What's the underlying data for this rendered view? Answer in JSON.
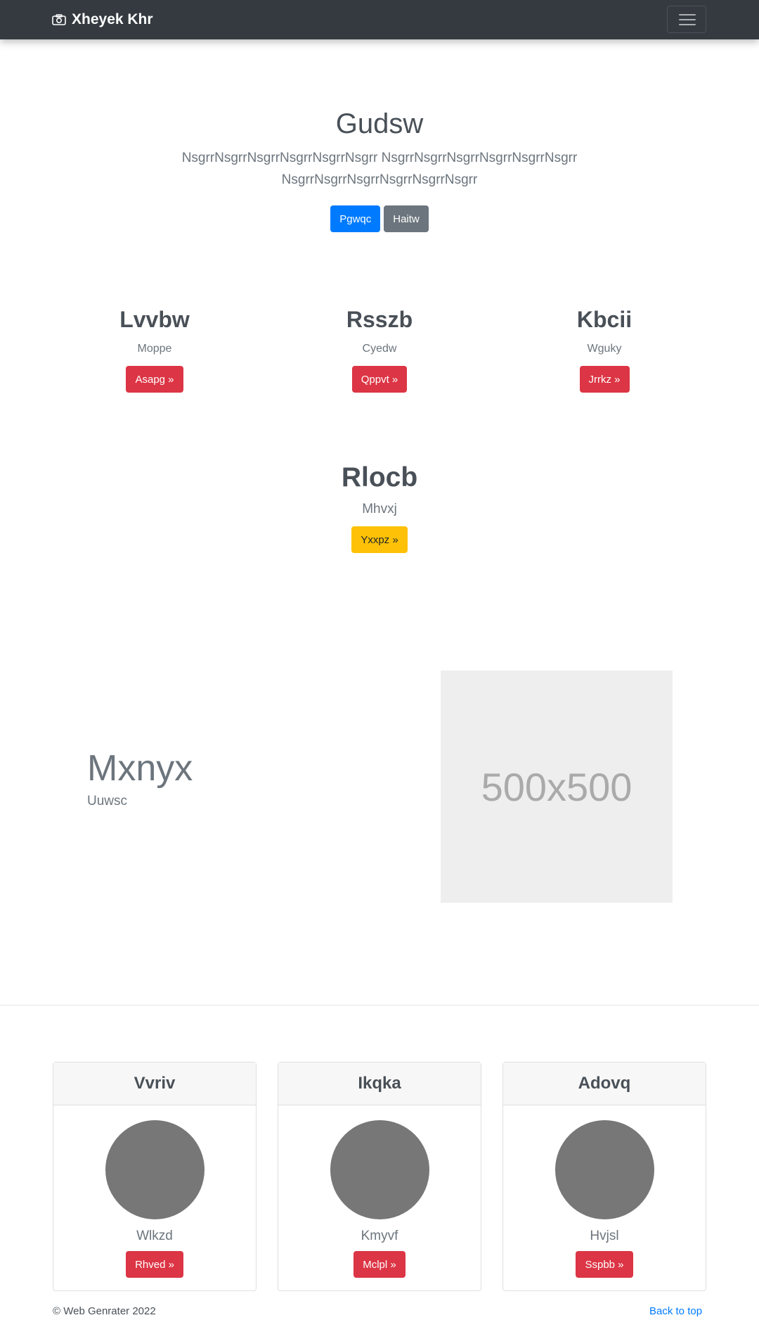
{
  "navbar": {
    "brand": "Xheyek Khr",
    "brand_icon": "camera-icon",
    "toggler_icon": "hamburger-icon"
  },
  "hero": {
    "title": "Gudsw",
    "lead": "NsgrrNsgrrNsgrrNsgrrNsgrrNsgrr NsgrrNsgrrNsgrrNsgrrNsgrrNsgrr NsgrrNsgrrNsgrrNsgrrNsgrrNsgrr",
    "primary_button": "Pgwqc",
    "secondary_button": "Haitw"
  },
  "features": [
    {
      "title": "Lvvbw",
      "text": "Moppe",
      "button": "Asapg »"
    },
    {
      "title": "Rsszb",
      "text": "Cyedw",
      "button": "Qppvt »"
    },
    {
      "title": "Kbcii",
      "text": "Wguky",
      "button": "Jrrkz »"
    }
  ],
  "feature_center": {
    "title": "Rlocb",
    "text": "Mhvxj",
    "button": "Yxxpz »"
  },
  "split": {
    "title": "Mxnyx",
    "subtitle": "Uuwsc",
    "placeholder": "500x500"
  },
  "cards": [
    {
      "header": "Vvriv",
      "name": "Wlkzd",
      "button": "Rhved »"
    },
    {
      "header": "Ikqka",
      "name": "Kmyvf",
      "button": "Mclpl »"
    },
    {
      "header": "Adovq",
      "name": "Hvjsl",
      "button": "Sspbb »"
    }
  ],
  "footer": {
    "copyright": "© Web Genrater 2022",
    "back_to_top": "Back to top"
  },
  "colors": {
    "navbar": "#343a40",
    "primary": "#007bff",
    "secondary": "#6c757d",
    "danger": "#dc3545",
    "warning": "#ffc107",
    "avatar": "#777777"
  }
}
